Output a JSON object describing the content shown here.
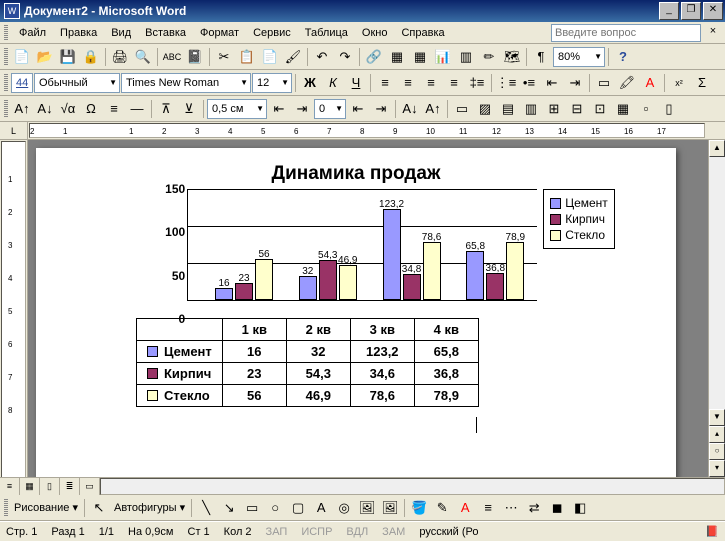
{
  "window": {
    "title": "Документ2 - Microsoft Word"
  },
  "menu": {
    "file": "Файл",
    "edit": "Правка",
    "view": "Вид",
    "insert": "Вставка",
    "format": "Формат",
    "tools": "Сервис",
    "table": "Таблица",
    "window": "Окно",
    "help": "Справка",
    "question_placeholder": "Введите вопрос"
  },
  "toolbar1": {
    "zoom": "80%"
  },
  "toolbar2": {
    "style_indicator": "44",
    "style": "Обычный",
    "font": "Times New Roman",
    "size": "12",
    "bold": "Ж",
    "italic": "К",
    "underline": "Ч"
  },
  "toolbar3": {
    "indent_val": "0,5 см",
    "spacing_val": "0"
  },
  "drawbar": {
    "drawing": "Рисование",
    "autoshapes": "Автофигуры"
  },
  "status": {
    "page": "Стр. 1",
    "section": "Разд 1",
    "pages": "1/1",
    "at": "На 0,9см",
    "line": "Ст 1",
    "col": "Кол 2",
    "rec": "ЗАП",
    "trk": "ИСПР",
    "ext": "ВДЛ",
    "ovr": "ЗАМ",
    "lang": "русский (Ро"
  },
  "chart_data": {
    "type": "bar",
    "title": "Динамика продаж",
    "categories": [
      "1 кв",
      "2 кв",
      "3 кв",
      "4 кв"
    ],
    "series": [
      {
        "name": "Цемент",
        "color": "#9999ff",
        "values": [
          16,
          32,
          123.2,
          65.8
        ],
        "labels": [
          "16",
          "32",
          "123,2",
          "65,8"
        ]
      },
      {
        "name": "Кирпич",
        "color": "#993366",
        "values": [
          23,
          54.3,
          34.6,
          36.8
        ],
        "labels": [
          "23",
          "54,3",
          "34,8",
          "36,8"
        ]
      },
      {
        "name": "Стекло",
        "color": "#ffffcc",
        "values": [
          56,
          46.9,
          78.6,
          78.9
        ],
        "labels": [
          "56",
          "46,9",
          "78,6",
          "78,9"
        ]
      }
    ],
    "ylabel": "",
    "ylim": [
      0,
      150
    ],
    "yticks": [
      0,
      50,
      100,
      150
    ]
  },
  "table": {
    "headers": [
      "",
      "1 кв",
      "2 кв",
      "3 кв",
      "4 кв"
    ],
    "rows": [
      {
        "name": "Цемент",
        "color": "#9999ff",
        "cells": [
          "16",
          "32",
          "123,2",
          "65,8"
        ]
      },
      {
        "name": "Кирпич",
        "color": "#993366",
        "cells": [
          "23",
          "54,3",
          "34,6",
          "36,8"
        ]
      },
      {
        "name": "Стекло",
        "color": "#ffffcc",
        "cells": [
          "56",
          "46,9",
          "78,6",
          "78,9"
        ]
      }
    ]
  },
  "ruler_h": [
    "2",
    "1",
    "",
    "1",
    "2",
    "3",
    "4",
    "5",
    "6",
    "7",
    "8",
    "9",
    "10",
    "11",
    "12",
    "13",
    "14",
    "15",
    "16",
    "17"
  ],
  "ruler_v": [
    "",
    "1",
    "2",
    "3",
    "4",
    "5",
    "6",
    "7",
    "8"
  ]
}
